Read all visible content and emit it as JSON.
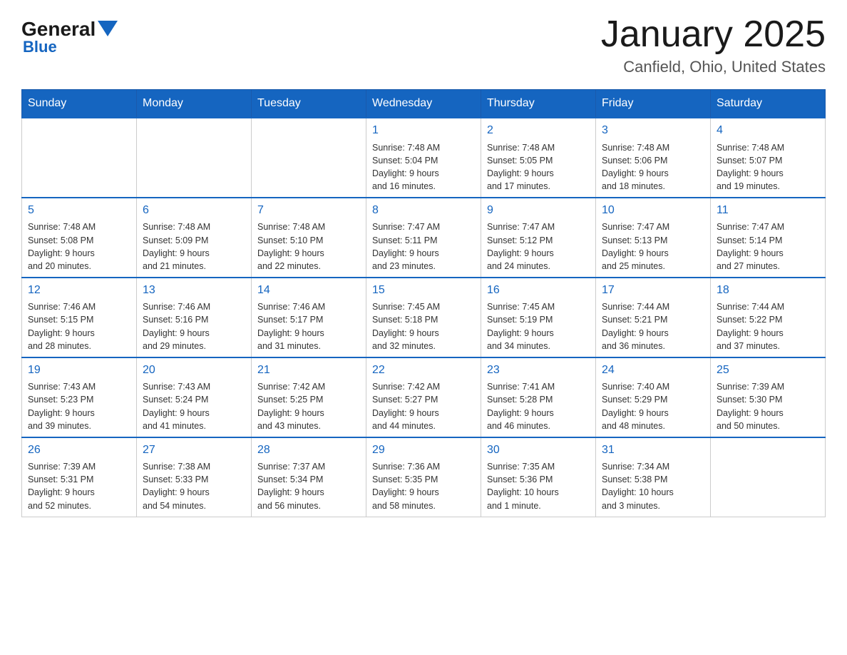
{
  "logo": {
    "general": "General",
    "blue": "Blue"
  },
  "title": "January 2025",
  "subtitle": "Canfield, Ohio, United States",
  "headers": [
    "Sunday",
    "Monday",
    "Tuesday",
    "Wednesday",
    "Thursday",
    "Friday",
    "Saturday"
  ],
  "weeks": [
    [
      {
        "day": "",
        "info": ""
      },
      {
        "day": "",
        "info": ""
      },
      {
        "day": "",
        "info": ""
      },
      {
        "day": "1",
        "info": "Sunrise: 7:48 AM\nSunset: 5:04 PM\nDaylight: 9 hours\nand 16 minutes."
      },
      {
        "day": "2",
        "info": "Sunrise: 7:48 AM\nSunset: 5:05 PM\nDaylight: 9 hours\nand 17 minutes."
      },
      {
        "day": "3",
        "info": "Sunrise: 7:48 AM\nSunset: 5:06 PM\nDaylight: 9 hours\nand 18 minutes."
      },
      {
        "day": "4",
        "info": "Sunrise: 7:48 AM\nSunset: 5:07 PM\nDaylight: 9 hours\nand 19 minutes."
      }
    ],
    [
      {
        "day": "5",
        "info": "Sunrise: 7:48 AM\nSunset: 5:08 PM\nDaylight: 9 hours\nand 20 minutes."
      },
      {
        "day": "6",
        "info": "Sunrise: 7:48 AM\nSunset: 5:09 PM\nDaylight: 9 hours\nand 21 minutes."
      },
      {
        "day": "7",
        "info": "Sunrise: 7:48 AM\nSunset: 5:10 PM\nDaylight: 9 hours\nand 22 minutes."
      },
      {
        "day": "8",
        "info": "Sunrise: 7:47 AM\nSunset: 5:11 PM\nDaylight: 9 hours\nand 23 minutes."
      },
      {
        "day": "9",
        "info": "Sunrise: 7:47 AM\nSunset: 5:12 PM\nDaylight: 9 hours\nand 24 minutes."
      },
      {
        "day": "10",
        "info": "Sunrise: 7:47 AM\nSunset: 5:13 PM\nDaylight: 9 hours\nand 25 minutes."
      },
      {
        "day": "11",
        "info": "Sunrise: 7:47 AM\nSunset: 5:14 PM\nDaylight: 9 hours\nand 27 minutes."
      }
    ],
    [
      {
        "day": "12",
        "info": "Sunrise: 7:46 AM\nSunset: 5:15 PM\nDaylight: 9 hours\nand 28 minutes."
      },
      {
        "day": "13",
        "info": "Sunrise: 7:46 AM\nSunset: 5:16 PM\nDaylight: 9 hours\nand 29 minutes."
      },
      {
        "day": "14",
        "info": "Sunrise: 7:46 AM\nSunset: 5:17 PM\nDaylight: 9 hours\nand 31 minutes."
      },
      {
        "day": "15",
        "info": "Sunrise: 7:45 AM\nSunset: 5:18 PM\nDaylight: 9 hours\nand 32 minutes."
      },
      {
        "day": "16",
        "info": "Sunrise: 7:45 AM\nSunset: 5:19 PM\nDaylight: 9 hours\nand 34 minutes."
      },
      {
        "day": "17",
        "info": "Sunrise: 7:44 AM\nSunset: 5:21 PM\nDaylight: 9 hours\nand 36 minutes."
      },
      {
        "day": "18",
        "info": "Sunrise: 7:44 AM\nSunset: 5:22 PM\nDaylight: 9 hours\nand 37 minutes."
      }
    ],
    [
      {
        "day": "19",
        "info": "Sunrise: 7:43 AM\nSunset: 5:23 PM\nDaylight: 9 hours\nand 39 minutes."
      },
      {
        "day": "20",
        "info": "Sunrise: 7:43 AM\nSunset: 5:24 PM\nDaylight: 9 hours\nand 41 minutes."
      },
      {
        "day": "21",
        "info": "Sunrise: 7:42 AM\nSunset: 5:25 PM\nDaylight: 9 hours\nand 43 minutes."
      },
      {
        "day": "22",
        "info": "Sunrise: 7:42 AM\nSunset: 5:27 PM\nDaylight: 9 hours\nand 44 minutes."
      },
      {
        "day": "23",
        "info": "Sunrise: 7:41 AM\nSunset: 5:28 PM\nDaylight: 9 hours\nand 46 minutes."
      },
      {
        "day": "24",
        "info": "Sunrise: 7:40 AM\nSunset: 5:29 PM\nDaylight: 9 hours\nand 48 minutes."
      },
      {
        "day": "25",
        "info": "Sunrise: 7:39 AM\nSunset: 5:30 PM\nDaylight: 9 hours\nand 50 minutes."
      }
    ],
    [
      {
        "day": "26",
        "info": "Sunrise: 7:39 AM\nSunset: 5:31 PM\nDaylight: 9 hours\nand 52 minutes."
      },
      {
        "day": "27",
        "info": "Sunrise: 7:38 AM\nSunset: 5:33 PM\nDaylight: 9 hours\nand 54 minutes."
      },
      {
        "day": "28",
        "info": "Sunrise: 7:37 AM\nSunset: 5:34 PM\nDaylight: 9 hours\nand 56 minutes."
      },
      {
        "day": "29",
        "info": "Sunrise: 7:36 AM\nSunset: 5:35 PM\nDaylight: 9 hours\nand 58 minutes."
      },
      {
        "day": "30",
        "info": "Sunrise: 7:35 AM\nSunset: 5:36 PM\nDaylight: 10 hours\nand 1 minute."
      },
      {
        "day": "31",
        "info": "Sunrise: 7:34 AM\nSunset: 5:38 PM\nDaylight: 10 hours\nand 3 minutes."
      },
      {
        "day": "",
        "info": ""
      }
    ]
  ]
}
